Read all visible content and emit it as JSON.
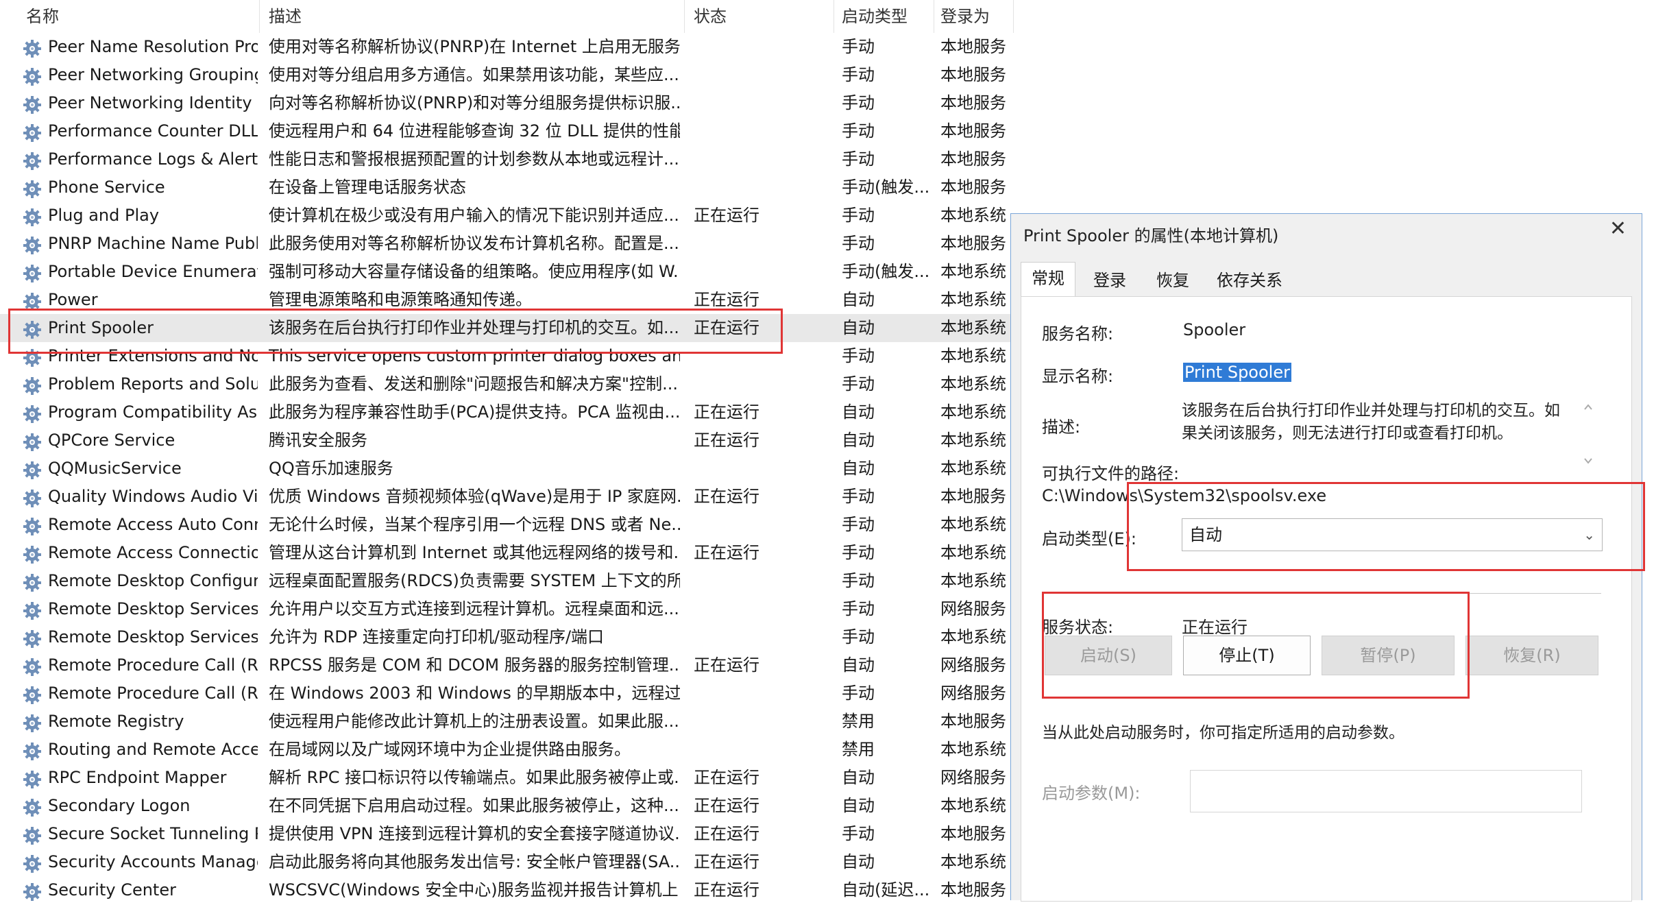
{
  "header": {
    "name": "名称",
    "desc": "描述",
    "status": "状态",
    "startup": "启动类型",
    "logon": "登录为"
  },
  "services": [
    {
      "name": "Peer Name Resolution Pro...",
      "desc": "使用对等名称解析协议(PNRP)在 Internet 上启用无服务...",
      "status": "",
      "startup": "手动",
      "logon": "本地服务"
    },
    {
      "name": "Peer Networking Grouping",
      "desc": "使用对等分组启用多方通信。如果禁用该功能，某些应...",
      "status": "",
      "startup": "手动",
      "logon": "本地服务"
    },
    {
      "name": "Peer Networking Identity ...",
      "desc": "向对等名称解析协议(PNRP)和对等分组服务提供标识服...",
      "status": "",
      "startup": "手动",
      "logon": "本地服务"
    },
    {
      "name": "Performance Counter DLL ...",
      "desc": "使远程用户和 64 位进程能够查询 32 位 DLL 提供的性能...",
      "status": "",
      "startup": "手动",
      "logon": "本地服务"
    },
    {
      "name": "Performance Logs & Alerts",
      "desc": "性能日志和警报根据预配置的计划参数从本地或远程计...",
      "status": "",
      "startup": "手动",
      "logon": "本地服务"
    },
    {
      "name": "Phone Service",
      "desc": "在设备上管理电话服务状态",
      "status": "",
      "startup": "手动(触发...",
      "logon": "本地服务"
    },
    {
      "name": "Plug and Play",
      "desc": "使计算机在极少或没有用户输入的情况下能识别并适应...",
      "status": "正在运行",
      "startup": "手动",
      "logon": "本地系统"
    },
    {
      "name": "PNRP Machine Name Publ...",
      "desc": "此服务使用对等名称解析协议发布计算机名称。配置是...",
      "status": "",
      "startup": "手动",
      "logon": "本地服务"
    },
    {
      "name": "Portable Device Enumerat...",
      "desc": "强制可移动大容量存储设备的组策略。使应用程序(如 W...",
      "status": "",
      "startup": "手动(触发...",
      "logon": "本地系统"
    },
    {
      "name": "Power",
      "desc": "管理电源策略和电源策略通知传递。",
      "status": "正在运行",
      "startup": "自动",
      "logon": "本地系统"
    },
    {
      "name": "Print Spooler",
      "desc": "该服务在后台执行打印作业并处理与打印机的交互。如...",
      "status": "正在运行",
      "startup": "自动",
      "logon": "本地系统"
    },
    {
      "name": "Printer Extensions and Noti...",
      "desc": "This service opens custom printer dialog boxes and ha...",
      "status": "",
      "startup": "手动",
      "logon": "本地系统"
    },
    {
      "name": "Problem Reports and Solut...",
      "desc": "此服务为查看、发送和删除\"问题报告和解决方案\"控制...",
      "status": "",
      "startup": "手动",
      "logon": "本地系统"
    },
    {
      "name": "Program Compatibility Assi...",
      "desc": "此服务为程序兼容性助手(PCA)提供支持。PCA 监视由...",
      "status": "正在运行",
      "startup": "自动",
      "logon": "本地系统"
    },
    {
      "name": "QPCore Service",
      "desc": "腾讯安全服务",
      "status": "正在运行",
      "startup": "自动",
      "logon": "本地系统"
    },
    {
      "name": "QQMusicService",
      "desc": "QQ音乐加速服务",
      "status": "",
      "startup": "自动",
      "logon": "本地系统"
    },
    {
      "name": "Quality Windows Audio Vi...",
      "desc": "优质 Windows 音频视频体验(qWave)是用于 IP 家庭网...",
      "status": "正在运行",
      "startup": "手动",
      "logon": "本地服务"
    },
    {
      "name": "Remote Access Auto Conn...",
      "desc": "无论什么时候，当某个程序引用一个远程 DNS 或者 Ne...",
      "status": "",
      "startup": "手动",
      "logon": "本地系统"
    },
    {
      "name": "Remote Access Connectio...",
      "desc": "管理从这台计算机到 Internet 或其他远程网络的拨号和...",
      "status": "正在运行",
      "startup": "手动",
      "logon": "本地系统"
    },
    {
      "name": "Remote Desktop Configur...",
      "desc": "远程桌面配置服务(RDCS)负责需要 SYSTEM 上下文的所...",
      "status": "",
      "startup": "手动",
      "logon": "本地系统"
    },
    {
      "name": "Remote Desktop Services",
      "desc": "允许用户以交互方式连接到远程计算机。远程桌面和远...",
      "status": "",
      "startup": "手动",
      "logon": "网络服务"
    },
    {
      "name": "Remote Desktop Services ...",
      "desc": "允许为 RDP 连接重定向打印机/驱动程序/端口",
      "status": "",
      "startup": "手动",
      "logon": "本地系统"
    },
    {
      "name": "Remote Procedure Call (R...",
      "desc": "RPCSS 服务是 COM 和 DCOM 服务器的服务控制管理...",
      "status": "正在运行",
      "startup": "自动",
      "logon": "网络服务"
    },
    {
      "name": "Remote Procedure Call (R...",
      "desc": "在 Windows 2003 和 Windows 的早期版本中，远程过...",
      "status": "",
      "startup": "手动",
      "logon": "网络服务"
    },
    {
      "name": "Remote Registry",
      "desc": "使远程用户能修改此计算机上的注册表设置。如果此服...",
      "status": "",
      "startup": "禁用",
      "logon": "本地服务"
    },
    {
      "name": "Routing and Remote Access",
      "desc": "在局域网以及广域网环境中为企业提供路由服务。",
      "status": "",
      "startup": "禁用",
      "logon": "本地系统"
    },
    {
      "name": "RPC Endpoint Mapper",
      "desc": "解析 RPC 接口标识符以传输端点。如果此服务被停止或...",
      "status": "正在运行",
      "startup": "自动",
      "logon": "网络服务"
    },
    {
      "name": "Secondary Logon",
      "desc": "在不同凭据下启用启动过程。如果此服务被停止，这种...",
      "status": "正在运行",
      "startup": "自动",
      "logon": "本地系统"
    },
    {
      "name": "Secure Socket Tunneling P...",
      "desc": "提供使用 VPN 连接到远程计算机的安全套接字隧道协议...",
      "status": "正在运行",
      "startup": "手动",
      "logon": "本地服务"
    },
    {
      "name": "Security Accounts Manager",
      "desc": "启动此服务将向其他服务发出信号: 安全帐户管理器(SA...",
      "status": "正在运行",
      "startup": "自动",
      "logon": "本地系统"
    },
    {
      "name": "Security Center",
      "desc": "WSCSVC(Windows 安全中心)服务监视并报告计算机上...",
      "status": "正在运行",
      "startup": "自动(延迟...",
      "logon": "本地服务"
    }
  ],
  "dialog": {
    "title": "Print Spooler 的属性(本地计算机)",
    "close": "✕",
    "tabs": [
      "常规",
      "登录",
      "恢复",
      "依存关系"
    ],
    "service_name_label": "服务名称:",
    "service_name": "Spooler",
    "display_name_label": "显示名称:",
    "display_name": "Print Spooler",
    "description_label": "描述:",
    "description": "该服务在后台执行打印作业并处理与打印机的交互。如果关闭该服务，则无法进行打印或查看打印机。",
    "exe_path_label": "可执行文件的路径:",
    "exe_path": "C:\\Windows\\System32\\spoolsv.exe",
    "startup_type_label": "启动类型(E):",
    "startup_type": "自动",
    "service_status_label": "服务状态:",
    "service_status": "正在运行",
    "buttons": {
      "start": "启动(S)",
      "stop": "停止(T)",
      "pause": "暂停(P)",
      "resume": "恢复(R)"
    },
    "hint": "当从此处启动服务时，你可指定所适用的启动参数。",
    "start_params_label": "启动参数(M):"
  },
  "colors": {
    "highlight_border": "#e03535",
    "selection_blue": "#2f7bd6",
    "dialog_border": "#7aa6d8"
  }
}
